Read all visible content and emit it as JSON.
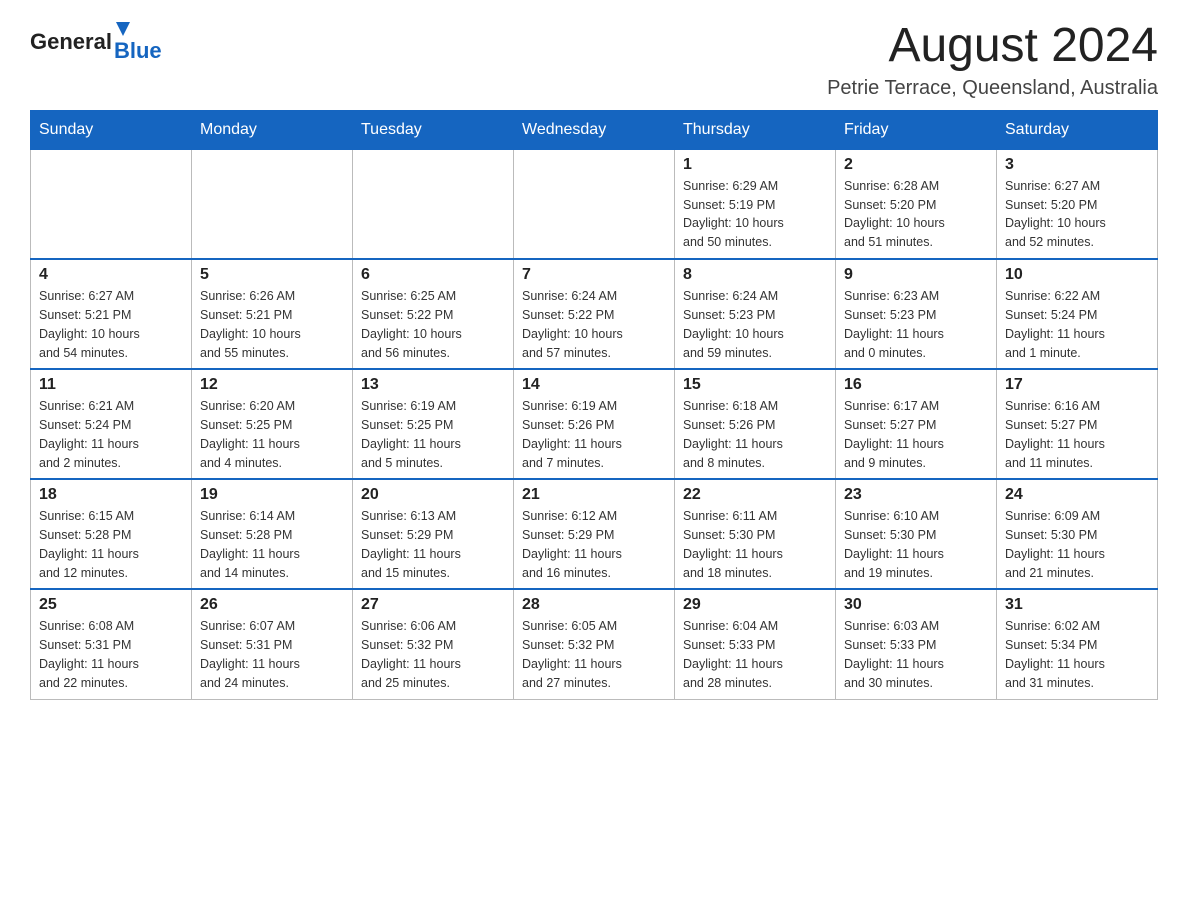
{
  "header": {
    "logo_general": "General",
    "logo_blue": "Blue",
    "month_title": "August 2024",
    "location": "Petrie Terrace, Queensland, Australia"
  },
  "weekdays": [
    "Sunday",
    "Monday",
    "Tuesday",
    "Wednesday",
    "Thursday",
    "Friday",
    "Saturday"
  ],
  "weeks": [
    [
      {
        "day": "",
        "info": ""
      },
      {
        "day": "",
        "info": ""
      },
      {
        "day": "",
        "info": ""
      },
      {
        "day": "",
        "info": ""
      },
      {
        "day": "1",
        "info": "Sunrise: 6:29 AM\nSunset: 5:19 PM\nDaylight: 10 hours\nand 50 minutes."
      },
      {
        "day": "2",
        "info": "Sunrise: 6:28 AM\nSunset: 5:20 PM\nDaylight: 10 hours\nand 51 minutes."
      },
      {
        "day": "3",
        "info": "Sunrise: 6:27 AM\nSunset: 5:20 PM\nDaylight: 10 hours\nand 52 minutes."
      }
    ],
    [
      {
        "day": "4",
        "info": "Sunrise: 6:27 AM\nSunset: 5:21 PM\nDaylight: 10 hours\nand 54 minutes."
      },
      {
        "day": "5",
        "info": "Sunrise: 6:26 AM\nSunset: 5:21 PM\nDaylight: 10 hours\nand 55 minutes."
      },
      {
        "day": "6",
        "info": "Sunrise: 6:25 AM\nSunset: 5:22 PM\nDaylight: 10 hours\nand 56 minutes."
      },
      {
        "day": "7",
        "info": "Sunrise: 6:24 AM\nSunset: 5:22 PM\nDaylight: 10 hours\nand 57 minutes."
      },
      {
        "day": "8",
        "info": "Sunrise: 6:24 AM\nSunset: 5:23 PM\nDaylight: 10 hours\nand 59 minutes."
      },
      {
        "day": "9",
        "info": "Sunrise: 6:23 AM\nSunset: 5:23 PM\nDaylight: 11 hours\nand 0 minutes."
      },
      {
        "day": "10",
        "info": "Sunrise: 6:22 AM\nSunset: 5:24 PM\nDaylight: 11 hours\nand 1 minute."
      }
    ],
    [
      {
        "day": "11",
        "info": "Sunrise: 6:21 AM\nSunset: 5:24 PM\nDaylight: 11 hours\nand 2 minutes."
      },
      {
        "day": "12",
        "info": "Sunrise: 6:20 AM\nSunset: 5:25 PM\nDaylight: 11 hours\nand 4 minutes."
      },
      {
        "day": "13",
        "info": "Sunrise: 6:19 AM\nSunset: 5:25 PM\nDaylight: 11 hours\nand 5 minutes."
      },
      {
        "day": "14",
        "info": "Sunrise: 6:19 AM\nSunset: 5:26 PM\nDaylight: 11 hours\nand 7 minutes."
      },
      {
        "day": "15",
        "info": "Sunrise: 6:18 AM\nSunset: 5:26 PM\nDaylight: 11 hours\nand 8 minutes."
      },
      {
        "day": "16",
        "info": "Sunrise: 6:17 AM\nSunset: 5:27 PM\nDaylight: 11 hours\nand 9 minutes."
      },
      {
        "day": "17",
        "info": "Sunrise: 6:16 AM\nSunset: 5:27 PM\nDaylight: 11 hours\nand 11 minutes."
      }
    ],
    [
      {
        "day": "18",
        "info": "Sunrise: 6:15 AM\nSunset: 5:28 PM\nDaylight: 11 hours\nand 12 minutes."
      },
      {
        "day": "19",
        "info": "Sunrise: 6:14 AM\nSunset: 5:28 PM\nDaylight: 11 hours\nand 14 minutes."
      },
      {
        "day": "20",
        "info": "Sunrise: 6:13 AM\nSunset: 5:29 PM\nDaylight: 11 hours\nand 15 minutes."
      },
      {
        "day": "21",
        "info": "Sunrise: 6:12 AM\nSunset: 5:29 PM\nDaylight: 11 hours\nand 16 minutes."
      },
      {
        "day": "22",
        "info": "Sunrise: 6:11 AM\nSunset: 5:30 PM\nDaylight: 11 hours\nand 18 minutes."
      },
      {
        "day": "23",
        "info": "Sunrise: 6:10 AM\nSunset: 5:30 PM\nDaylight: 11 hours\nand 19 minutes."
      },
      {
        "day": "24",
        "info": "Sunrise: 6:09 AM\nSunset: 5:30 PM\nDaylight: 11 hours\nand 21 minutes."
      }
    ],
    [
      {
        "day": "25",
        "info": "Sunrise: 6:08 AM\nSunset: 5:31 PM\nDaylight: 11 hours\nand 22 minutes."
      },
      {
        "day": "26",
        "info": "Sunrise: 6:07 AM\nSunset: 5:31 PM\nDaylight: 11 hours\nand 24 minutes."
      },
      {
        "day": "27",
        "info": "Sunrise: 6:06 AM\nSunset: 5:32 PM\nDaylight: 11 hours\nand 25 minutes."
      },
      {
        "day": "28",
        "info": "Sunrise: 6:05 AM\nSunset: 5:32 PM\nDaylight: 11 hours\nand 27 minutes."
      },
      {
        "day": "29",
        "info": "Sunrise: 6:04 AM\nSunset: 5:33 PM\nDaylight: 11 hours\nand 28 minutes."
      },
      {
        "day": "30",
        "info": "Sunrise: 6:03 AM\nSunset: 5:33 PM\nDaylight: 11 hours\nand 30 minutes."
      },
      {
        "day": "31",
        "info": "Sunrise: 6:02 AM\nSunset: 5:34 PM\nDaylight: 11 hours\nand 31 minutes."
      }
    ]
  ]
}
